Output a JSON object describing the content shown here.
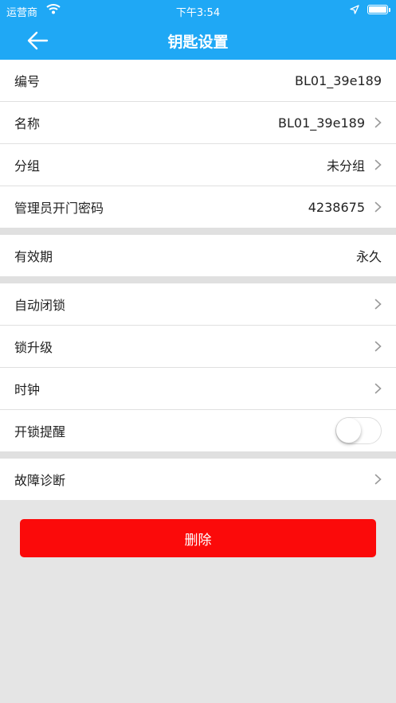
{
  "status": {
    "carrier": "运营商",
    "time": "下午3:54"
  },
  "header": {
    "title": "钥匙设置"
  },
  "groups": [
    {
      "rows": [
        {
          "label": "编号",
          "value": "BL01_39e189",
          "chevron": false
        },
        {
          "label": "名称",
          "value": "BL01_39e189",
          "chevron": true
        },
        {
          "label": "分组",
          "value": "未分组",
          "chevron": true
        },
        {
          "label": "管理员开门密码",
          "value": "4238675",
          "chevron": true
        }
      ]
    },
    {
      "rows": [
        {
          "label": "有效期",
          "value": "永久",
          "chevron": false
        }
      ]
    },
    {
      "rows": [
        {
          "label": "自动闭锁",
          "chevron": true
        },
        {
          "label": "锁升级",
          "chevron": true
        },
        {
          "label": "时钟",
          "chevron": true
        },
        {
          "label": "开锁提醒",
          "toggle": false
        }
      ]
    },
    {
      "rows": [
        {
          "label": "故障诊断",
          "chevron": true
        }
      ]
    }
  ],
  "delete_label": "删除",
  "colors": {
    "header": "#1fa8f5",
    "delete": "#fb0a0a"
  }
}
